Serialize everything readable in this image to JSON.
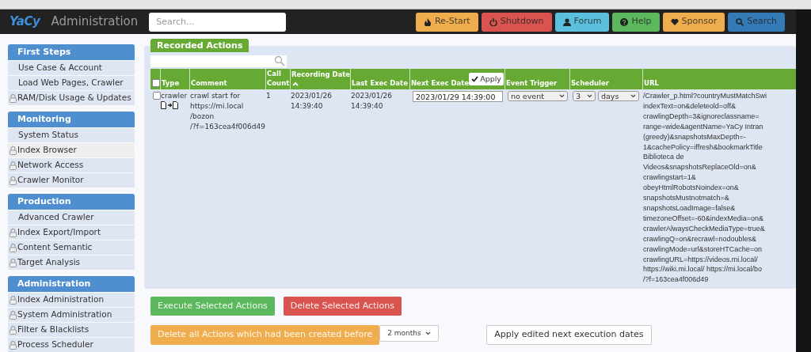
{
  "header": {
    "logo": "YaCy",
    "title": "Administration",
    "search": {
      "placeholder": "Search..."
    },
    "buttons": [
      {
        "label": "Re-Start",
        "kind": "restart"
      },
      {
        "label": "Shutdown",
        "kind": "shutdown"
      },
      {
        "label": "Forum",
        "kind": "forum"
      },
      {
        "label": "Help",
        "kind": "help"
      },
      {
        "label": "Sponsor",
        "kind": "sponsor"
      },
      {
        "label": "Search",
        "kind": "search"
      }
    ]
  },
  "sidebar": {
    "sections": [
      {
        "title": "First Steps",
        "items": [
          {
            "label": "Use Case & Account",
            "locked": false,
            "selected": false
          },
          {
            "label": "Load Web Pages, Crawler",
            "locked": false,
            "selected": false
          },
          {
            "label": "RAM/Disk Usage & Updates",
            "locked": true,
            "selected": false
          }
        ]
      },
      {
        "title": "Monitoring",
        "items": [
          {
            "label": "System Status",
            "locked": false,
            "selected": false
          },
          {
            "label": "Index Browser",
            "locked": true,
            "selected": true
          },
          {
            "label": "Network Access",
            "locked": true,
            "selected": false
          },
          {
            "label": "Crawler Monitor",
            "locked": true,
            "selected": false
          }
        ]
      },
      {
        "title": "Production",
        "items": [
          {
            "label": "Advanced Crawler",
            "locked": false,
            "selected": false
          },
          {
            "label": "Index Export/Import",
            "locked": true,
            "selected": false
          },
          {
            "label": "Content Semantic",
            "locked": true,
            "selected": false
          },
          {
            "label": "Target Analysis",
            "locked": true,
            "selected": false
          }
        ]
      },
      {
        "title": "Administration",
        "items": [
          {
            "label": "Index Administration",
            "locked": true,
            "selected": false
          },
          {
            "label": "System Administration",
            "locked": true,
            "selected": false
          },
          {
            "label": "Filter & Blacklists",
            "locked": true,
            "selected": false
          },
          {
            "label": "Process Scheduler",
            "locked": true,
            "selected": false
          }
        ]
      }
    ]
  },
  "panel": {
    "tab": "Recorded Actions",
    "table": {
      "select_all": {
        "checked": false
      },
      "columns": [
        {
          "label": "Type",
          "sorted": false
        },
        {
          "label": "Comment",
          "sorted": false
        },
        {
          "label": "Call Count",
          "sorted": false
        },
        {
          "label": "Recording Date",
          "sorted": true
        },
        {
          "label": "Last Exec Date",
          "sorted": false
        },
        {
          "label": "Next Exec Date",
          "sorted": false,
          "button": "Apply"
        },
        {
          "label": "Event Trigger",
          "sorted": false
        },
        {
          "label": "Scheduler",
          "sorted": false
        },
        {
          "label": "URL",
          "sorted": false
        }
      ],
      "rows": [
        {
          "checked": false,
          "type": "crawler",
          "comment": "crawl start for\nhttps://mi.local\n/bozon\n/?f=163cea4f006d49",
          "call_count": "1",
          "recording_date": "2023/01/26\n14:39:40",
          "last_exec_date": "2023/01/26\n14:39:40",
          "next_exec_date": "2023/01/29 14:39:00",
          "event_trigger": "no event",
          "scheduler_count": "3",
          "scheduler_unit": "days",
          "url": "/Crawler_p.html?countryMustMatchSwi\nindexText=on&deleteold=off&\ncrawlingDepth=3&ignoreclassname=\nrange=wide&agentName=YaCy Intran\n(greedy)&snapshotsMaxDepth=-\n1&cachePolicy=iffresh&bookmarkTitle\nBiblioteca de\nVideos&snapshotsReplaceOld=on&\ncrawlingstart=1&\nobeyHtmlRobotsNoindex=on&\nsnapshotsMustnotmatch=&\nsnapshotsLoadImage=false&\ntimezoneOffset=-60&indexMedia=on&\ncrawlerAlwaysCheckMediaType=true&\ncrawlingQ=on&recrawl=nodoubles&\ncrawlingMode=url&storeHTCache=on\ncrawlingURL=https://videos.mi.local/\nhttps://wiki.mi.local/ https://mi.local/bo\n/?f=163cea4f006d49"
        }
      ]
    }
  },
  "actions": {
    "execute": "Execute Selected Actions",
    "delete": "Delete Selected Actions",
    "delete_before": "Delete all Actions which had been created before",
    "period": "2 months",
    "apply_dates": "Apply edited next execution dates"
  }
}
